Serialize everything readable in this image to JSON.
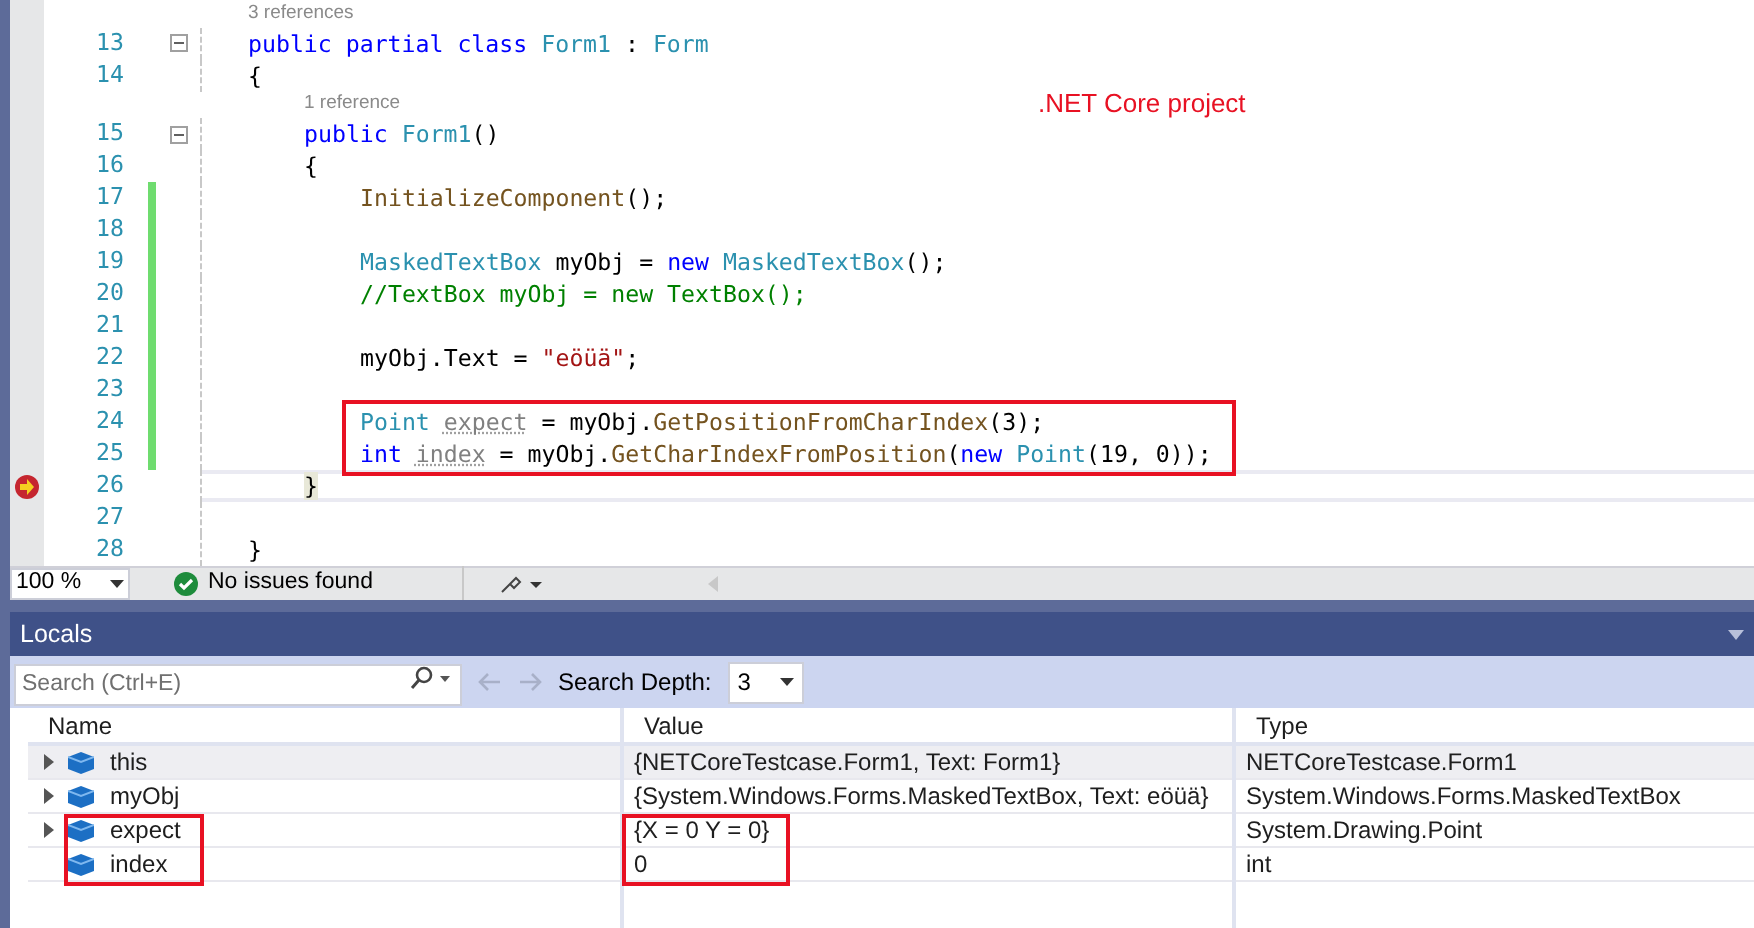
{
  "editor": {
    "annotation": ".NET Core project",
    "lines": [
      {
        "kind": "lens",
        "text": "3 references"
      },
      {
        "kind": "code",
        "number": "13",
        "changed": false,
        "collapsible": true,
        "current": false,
        "highlighted": false,
        "tokens": [
          {
            "t": "public partial class",
            "kind": "kw"
          },
          {
            "t": " Form1",
            "kind": "type"
          },
          {
            "t": " : ",
            "kind": "plain"
          },
          {
            "t": "Form",
            "kind": "type"
          }
        ]
      },
      {
        "kind": "code",
        "number": "14",
        "changed": false,
        "collapsible": false,
        "current": false,
        "highlighted": false,
        "tokens": [
          {
            "t": "{",
            "kind": "plain"
          }
        ],
        "children": [
          {
            "kind": "lens",
            "text": "1 reference"
          },
          {
            "kind": "code",
            "number": "15",
            "changed": false,
            "collapsible": true,
            "current": false,
            "highlighted": false,
            "tokens": [
              {
                "t": "public",
                "kind": "kw"
              },
              {
                "t": " Form1",
                "kind": "type"
              },
              {
                "t": "()",
                "kind": "plain"
              }
            ]
          },
          {
            "kind": "code",
            "number": "16",
            "changed": false,
            "collapsible": false,
            "current": false,
            "highlighted": false,
            "tokens": [
              {
                "t": "{",
                "kind": "plain"
              }
            ],
            "children": [
              {
                "kind": "code",
                "number": "17",
                "changed": true,
                "collapsible": false,
                "current": false,
                "highlighted": false,
                "tokens": [
                  {
                    "t": "InitializeComponent",
                    "kind": "method"
                  },
                  {
                    "t": "();",
                    "kind": "plain"
                  }
                ]
              },
              {
                "kind": "code",
                "number": "18",
                "changed": true,
                "collapsible": false,
                "current": false,
                "highlighted": false
              },
              {
                "kind": "code",
                "number": "19",
                "changed": true,
                "collapsible": false,
                "current": false,
                "highlighted": false,
                "tokens": [
                  {
                    "t": "MaskedTextBox",
                    "kind": "type"
                  },
                  {
                    "t": " myObj = ",
                    "kind": "plain"
                  },
                  {
                    "t": "new",
                    "kind": "kw"
                  },
                  {
                    "t": " MaskedTextBox",
                    "kind": "type"
                  },
                  {
                    "t": "();",
                    "kind": "plain"
                  }
                ]
              },
              {
                "kind": "code",
                "number": "20",
                "changed": true,
                "collapsible": false,
                "current": false,
                "highlighted": false,
                "tokens": [
                  {
                    "t": "//TextBox myObj = new TextBox();",
                    "kind": "comment"
                  }
                ]
              },
              {
                "kind": "code",
                "number": "21",
                "changed": true,
                "collapsible": false,
                "current": false,
                "highlighted": false
              },
              {
                "kind": "code",
                "number": "22",
                "changed": true,
                "collapsible": false,
                "current": false,
                "highlighted": false,
                "tokens": [
                  {
                    "t": "myObj.Text = ",
                    "kind": "plain"
                  },
                  {
                    "t": "\"eöüä\"",
                    "kind": "string"
                  },
                  {
                    "t": ";",
                    "kind": "plain"
                  }
                ]
              },
              {
                "kind": "code",
                "number": "23",
                "changed": true,
                "collapsible": false,
                "current": false,
                "highlighted": false
              },
              {
                "kind": "code",
                "number": "24",
                "changed": true,
                "collapsible": false,
                "current": false,
                "highlighted": true,
                "tokens": [
                  {
                    "t": "Point ",
                    "kind": "type"
                  },
                  {
                    "t": "expect",
                    "kind": "unused"
                  },
                  {
                    "t": " = myObj.",
                    "kind": "plain"
                  },
                  {
                    "t": "GetPositionFromCharIndex",
                    "kind": "method"
                  },
                  {
                    "t": "(3);",
                    "kind": "plain"
                  }
                ]
              },
              {
                "kind": "code",
                "number": "25",
                "changed": true,
                "collapsible": false,
                "current": false,
                "highlighted": true,
                "tokens": [
                  {
                    "t": "int ",
                    "kind": "kw"
                  },
                  {
                    "t": "index",
                    "kind": "unused"
                  },
                  {
                    "t": " = myObj.",
                    "kind": "plain"
                  },
                  {
                    "t": "GetCharIndexFromPosition",
                    "kind": "method"
                  },
                  {
                    "t": "(",
                    "kind": "plain"
                  },
                  {
                    "t": "new ",
                    "kind": "kw"
                  },
                  {
                    "t": "Point",
                    "kind": "type"
                  },
                  {
                    "t": "(19, 0));",
                    "kind": "plain"
                  }
                ]
              }
            ]
          },
          {
            "kind": "code",
            "number": "26",
            "changed": false,
            "collapsible": false,
            "current": true,
            "highlighted": false,
            "tokens": [
              {
                "t": "}",
                "kind": "plain"
              }
            ]
          },
          {
            "kind": "code",
            "number": "27",
            "changed": false,
            "collapsible": false,
            "current": false,
            "highlighted": false
          }
        ]
      },
      {
        "kind": "code",
        "number": "28",
        "changed": false,
        "collapsible": false,
        "current": false,
        "highlighted": false,
        "tokens": [
          {
            "t": "}",
            "kind": "plain"
          }
        ]
      }
    ]
  },
  "status_bar": {
    "zoom": "100 %",
    "issues": "No issues found"
  },
  "locals": {
    "title": "Locals",
    "search": {
      "placeholder": "Search (Ctrl+E)"
    },
    "depth_label": "Search Depth:",
    "depth": "3",
    "columns": [
      "Name",
      "Value",
      "Type"
    ],
    "rows": [
      {
        "name": "this",
        "value": "{NETCoreTestcase.Form1, Text: Form1}",
        "type": "NETCoreTestcase.Form1",
        "expandable": true,
        "selected": true,
        "highlighted": false
      },
      {
        "name": "myObj",
        "value": "{System.Windows.Forms.MaskedTextBox, Text: eöüä}",
        "type": "System.Windows.Forms.MaskedTextBox",
        "expandable": true,
        "selected": false,
        "highlighted": false
      },
      {
        "name": "expect",
        "value": "{X = 0 Y = 0}",
        "type": "System.Drawing.Point",
        "expandable": true,
        "selected": false,
        "highlighted": true
      },
      {
        "name": "index",
        "value": "0",
        "type": "int",
        "expandable": false,
        "selected": false,
        "highlighted": true
      }
    ]
  }
}
